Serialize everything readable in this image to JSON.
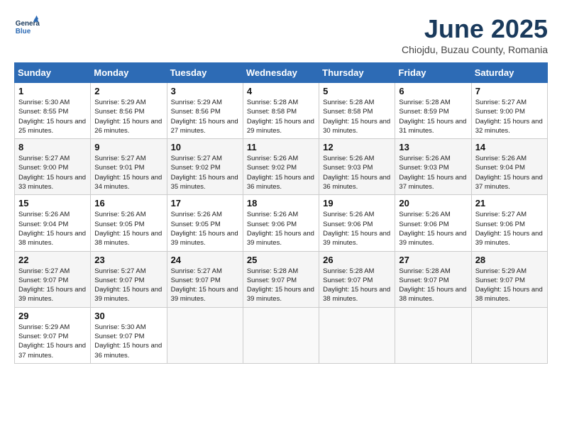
{
  "header": {
    "logo_line1": "General",
    "logo_line2": "Blue",
    "month_title": "June 2025",
    "location": "Chiojdu, Buzau County, Romania"
  },
  "weekdays": [
    "Sunday",
    "Monday",
    "Tuesday",
    "Wednesday",
    "Thursday",
    "Friday",
    "Saturday"
  ],
  "weeks": [
    [
      {
        "day": "1",
        "sunrise": "5:30 AM",
        "sunset": "8:55 PM",
        "daylight": "15 hours and 25 minutes."
      },
      {
        "day": "2",
        "sunrise": "5:29 AM",
        "sunset": "8:56 PM",
        "daylight": "15 hours and 26 minutes."
      },
      {
        "day": "3",
        "sunrise": "5:29 AM",
        "sunset": "8:56 PM",
        "daylight": "15 hours and 27 minutes."
      },
      {
        "day": "4",
        "sunrise": "5:28 AM",
        "sunset": "8:58 PM",
        "daylight": "15 hours and 29 minutes."
      },
      {
        "day": "5",
        "sunrise": "5:28 AM",
        "sunset": "8:58 PM",
        "daylight": "15 hours and 30 minutes."
      },
      {
        "day": "6",
        "sunrise": "5:28 AM",
        "sunset": "8:59 PM",
        "daylight": "15 hours and 31 minutes."
      },
      {
        "day": "7",
        "sunrise": "5:27 AM",
        "sunset": "9:00 PM",
        "daylight": "15 hours and 32 minutes."
      }
    ],
    [
      {
        "day": "8",
        "sunrise": "5:27 AM",
        "sunset": "9:00 PM",
        "daylight": "15 hours and 33 minutes."
      },
      {
        "day": "9",
        "sunrise": "5:27 AM",
        "sunset": "9:01 PM",
        "daylight": "15 hours and 34 minutes."
      },
      {
        "day": "10",
        "sunrise": "5:27 AM",
        "sunset": "9:02 PM",
        "daylight": "15 hours and 35 minutes."
      },
      {
        "day": "11",
        "sunrise": "5:26 AM",
        "sunset": "9:02 PM",
        "daylight": "15 hours and 36 minutes."
      },
      {
        "day": "12",
        "sunrise": "5:26 AM",
        "sunset": "9:03 PM",
        "daylight": "15 hours and 36 minutes."
      },
      {
        "day": "13",
        "sunrise": "5:26 AM",
        "sunset": "9:03 PM",
        "daylight": "15 hours and 37 minutes."
      },
      {
        "day": "14",
        "sunrise": "5:26 AM",
        "sunset": "9:04 PM",
        "daylight": "15 hours and 37 minutes."
      }
    ],
    [
      {
        "day": "15",
        "sunrise": "5:26 AM",
        "sunset": "9:04 PM",
        "daylight": "15 hours and 38 minutes."
      },
      {
        "day": "16",
        "sunrise": "5:26 AM",
        "sunset": "9:05 PM",
        "daylight": "15 hours and 38 minutes."
      },
      {
        "day": "17",
        "sunrise": "5:26 AM",
        "sunset": "9:05 PM",
        "daylight": "15 hours and 39 minutes."
      },
      {
        "day": "18",
        "sunrise": "5:26 AM",
        "sunset": "9:06 PM",
        "daylight": "15 hours and 39 minutes."
      },
      {
        "day": "19",
        "sunrise": "5:26 AM",
        "sunset": "9:06 PM",
        "daylight": "15 hours and 39 minutes."
      },
      {
        "day": "20",
        "sunrise": "5:26 AM",
        "sunset": "9:06 PM",
        "daylight": "15 hours and 39 minutes."
      },
      {
        "day": "21",
        "sunrise": "5:27 AM",
        "sunset": "9:06 PM",
        "daylight": "15 hours and 39 minutes."
      }
    ],
    [
      {
        "day": "22",
        "sunrise": "5:27 AM",
        "sunset": "9:07 PM",
        "daylight": "15 hours and 39 minutes."
      },
      {
        "day": "23",
        "sunrise": "5:27 AM",
        "sunset": "9:07 PM",
        "daylight": "15 hours and 39 minutes."
      },
      {
        "day": "24",
        "sunrise": "5:27 AM",
        "sunset": "9:07 PM",
        "daylight": "15 hours and 39 minutes."
      },
      {
        "day": "25",
        "sunrise": "5:28 AM",
        "sunset": "9:07 PM",
        "daylight": "15 hours and 39 minutes."
      },
      {
        "day": "26",
        "sunrise": "5:28 AM",
        "sunset": "9:07 PM",
        "daylight": "15 hours and 38 minutes."
      },
      {
        "day": "27",
        "sunrise": "5:28 AM",
        "sunset": "9:07 PM",
        "daylight": "15 hours and 38 minutes."
      },
      {
        "day": "28",
        "sunrise": "5:29 AM",
        "sunset": "9:07 PM",
        "daylight": "15 hours and 38 minutes."
      }
    ],
    [
      {
        "day": "29",
        "sunrise": "5:29 AM",
        "sunset": "9:07 PM",
        "daylight": "15 hours and 37 minutes."
      },
      {
        "day": "30",
        "sunrise": "5:30 AM",
        "sunset": "9:07 PM",
        "daylight": "15 hours and 36 minutes."
      },
      null,
      null,
      null,
      null,
      null
    ]
  ],
  "labels": {
    "sunrise_prefix": "Sunrise: ",
    "sunset_prefix": "Sunset: ",
    "daylight_prefix": "Daylight: "
  }
}
